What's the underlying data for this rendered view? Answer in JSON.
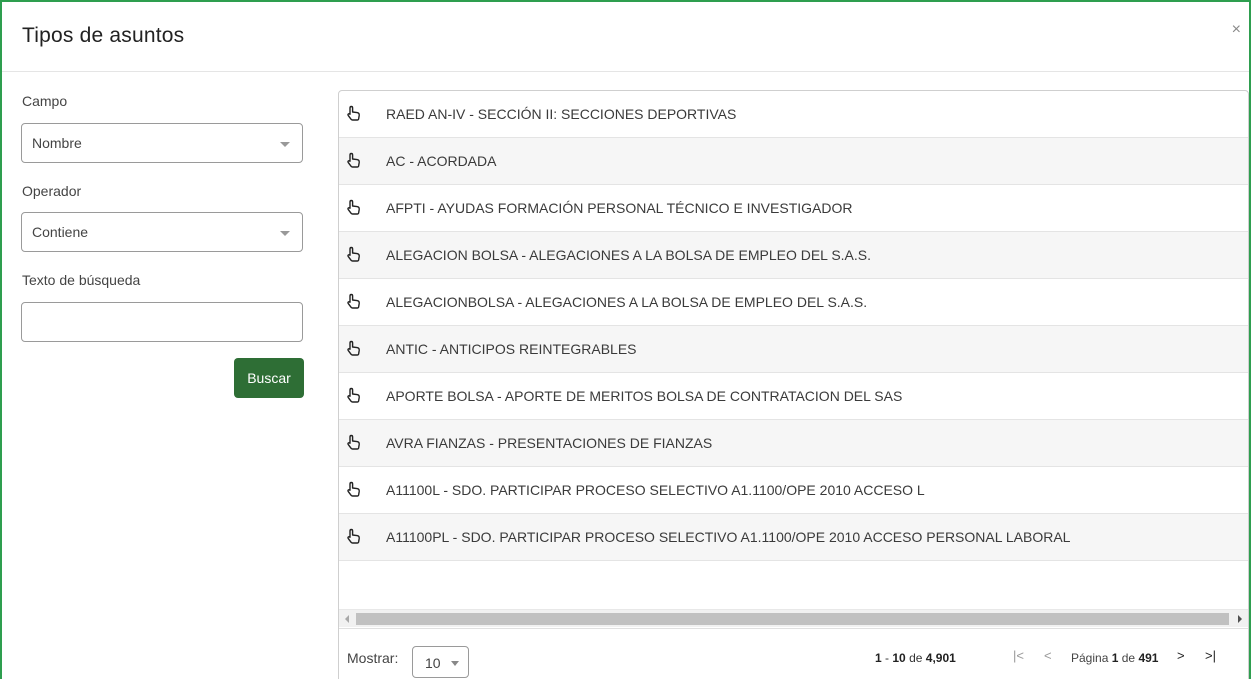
{
  "modal": {
    "title": "Tipos de asuntos",
    "close_label": "×"
  },
  "filters": {
    "campo": {
      "label": "Campo",
      "value": "Nombre"
    },
    "operador": {
      "label": "Operador",
      "value": "Contiene"
    },
    "texto": {
      "label": "Texto de búsqueda",
      "value": "",
      "placeholder": ""
    },
    "search_button": "Buscar"
  },
  "grid": {
    "rows": [
      {
        "label": "RAED AN-IV - SECCIÓN II: SECCIONES DEPORTIVAS"
      },
      {
        "label": "AC - ACORDADA"
      },
      {
        "label": "AFPTI - AYUDAS FORMACIÓN PERSONAL TÉCNICO E INVESTIGADOR"
      },
      {
        "label": "ALEGACION BOLSA - ALEGACIONES A LA BOLSA DE EMPLEO DEL S.A.S."
      },
      {
        "label": "ALEGACIONBOLSA - ALEGACIONES A LA BOLSA DE EMPLEO DEL S.A.S."
      },
      {
        "label": "ANTIC - ANTICIPOS REINTEGRABLES"
      },
      {
        "label": "APORTE BOLSA - APORTE DE MERITOS BOLSA DE CONTRATACION DEL SAS"
      },
      {
        "label": "AVRA FIANZAS - PRESENTACIONES DE FIANZAS"
      },
      {
        "label": "A11100L - SDO. PARTICIPAR PROCESO SELECTIVO A1.1100/OPE 2010 ACCESO L"
      },
      {
        "label": "A11100PL - SDO. PARTICIPAR PROCESO SELECTIVO A1.1100/OPE 2010 ACCESO PERSONAL LABORAL"
      }
    ],
    "row_icon": "hand-pointer-icon"
  },
  "pager": {
    "show_label": "Mostrar:",
    "page_size": "10",
    "range_start": "1",
    "range_end": "10",
    "range_of": "de",
    "total": "4,901",
    "page_label": "Página",
    "page": "1",
    "page_of": "de",
    "pages": "491",
    "first_glyph": "|<",
    "prev_glyph": "<",
    "next_glyph": ">",
    "last_glyph": ">|"
  },
  "colors": {
    "modal_border": "#2e9e4f",
    "button": "#2e6e35"
  }
}
